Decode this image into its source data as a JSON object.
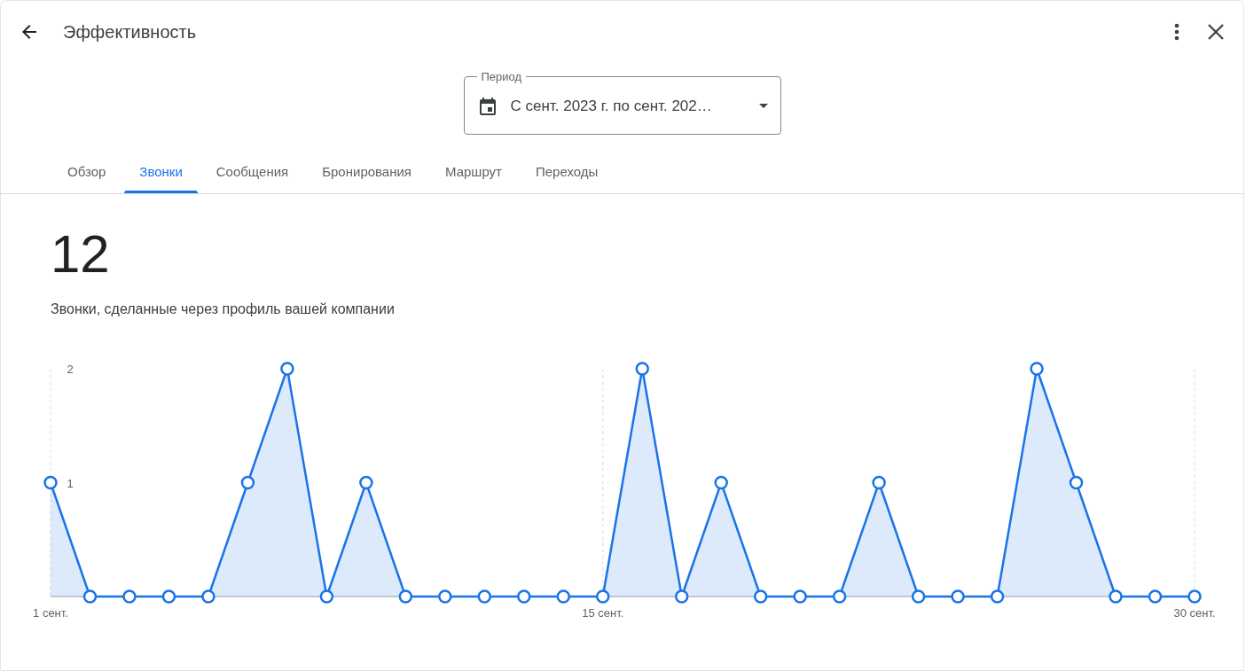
{
  "header": {
    "title": "Эффективность"
  },
  "period": {
    "label": "Период",
    "value": "С сент. 2023 г. по сент. 202…"
  },
  "tabs": [
    {
      "label": "Обзор",
      "selected": false
    },
    {
      "label": "Звонки",
      "selected": true
    },
    {
      "label": "Сообщения",
      "selected": false
    },
    {
      "label": "Бронирования",
      "selected": false
    },
    {
      "label": "Маршрут",
      "selected": false
    },
    {
      "label": "Переходы",
      "selected": false
    }
  ],
  "stat": {
    "value": "12",
    "caption": "Звонки, сделанные через профиль вашей компании"
  },
  "chart_data": {
    "type": "area",
    "x": [
      1,
      2,
      3,
      4,
      5,
      6,
      7,
      8,
      9,
      10,
      11,
      12,
      13,
      14,
      15,
      16,
      17,
      18,
      19,
      20,
      21,
      22,
      23,
      24,
      25,
      26,
      27,
      28,
      29,
      30
    ],
    "series": [
      {
        "color": "#1a73e8",
        "values": [
          1,
          0,
          0,
          0,
          0,
          1,
          2,
          0,
          1,
          0,
          0,
          0,
          0,
          0,
          0,
          2,
          0,
          1,
          0,
          0,
          0,
          1,
          0,
          0,
          0,
          2,
          1,
          0,
          0,
          0
        ]
      }
    ],
    "xlim": [
      1,
      30
    ],
    "ylim": [
      0,
      2
    ],
    "xticks": [
      {
        "value": 1,
        "label": "1 сент."
      },
      {
        "value": 15,
        "label": "15 сент."
      },
      {
        "value": 30,
        "label": "30 сент."
      }
    ],
    "yticks": [
      1,
      2
    ]
  }
}
